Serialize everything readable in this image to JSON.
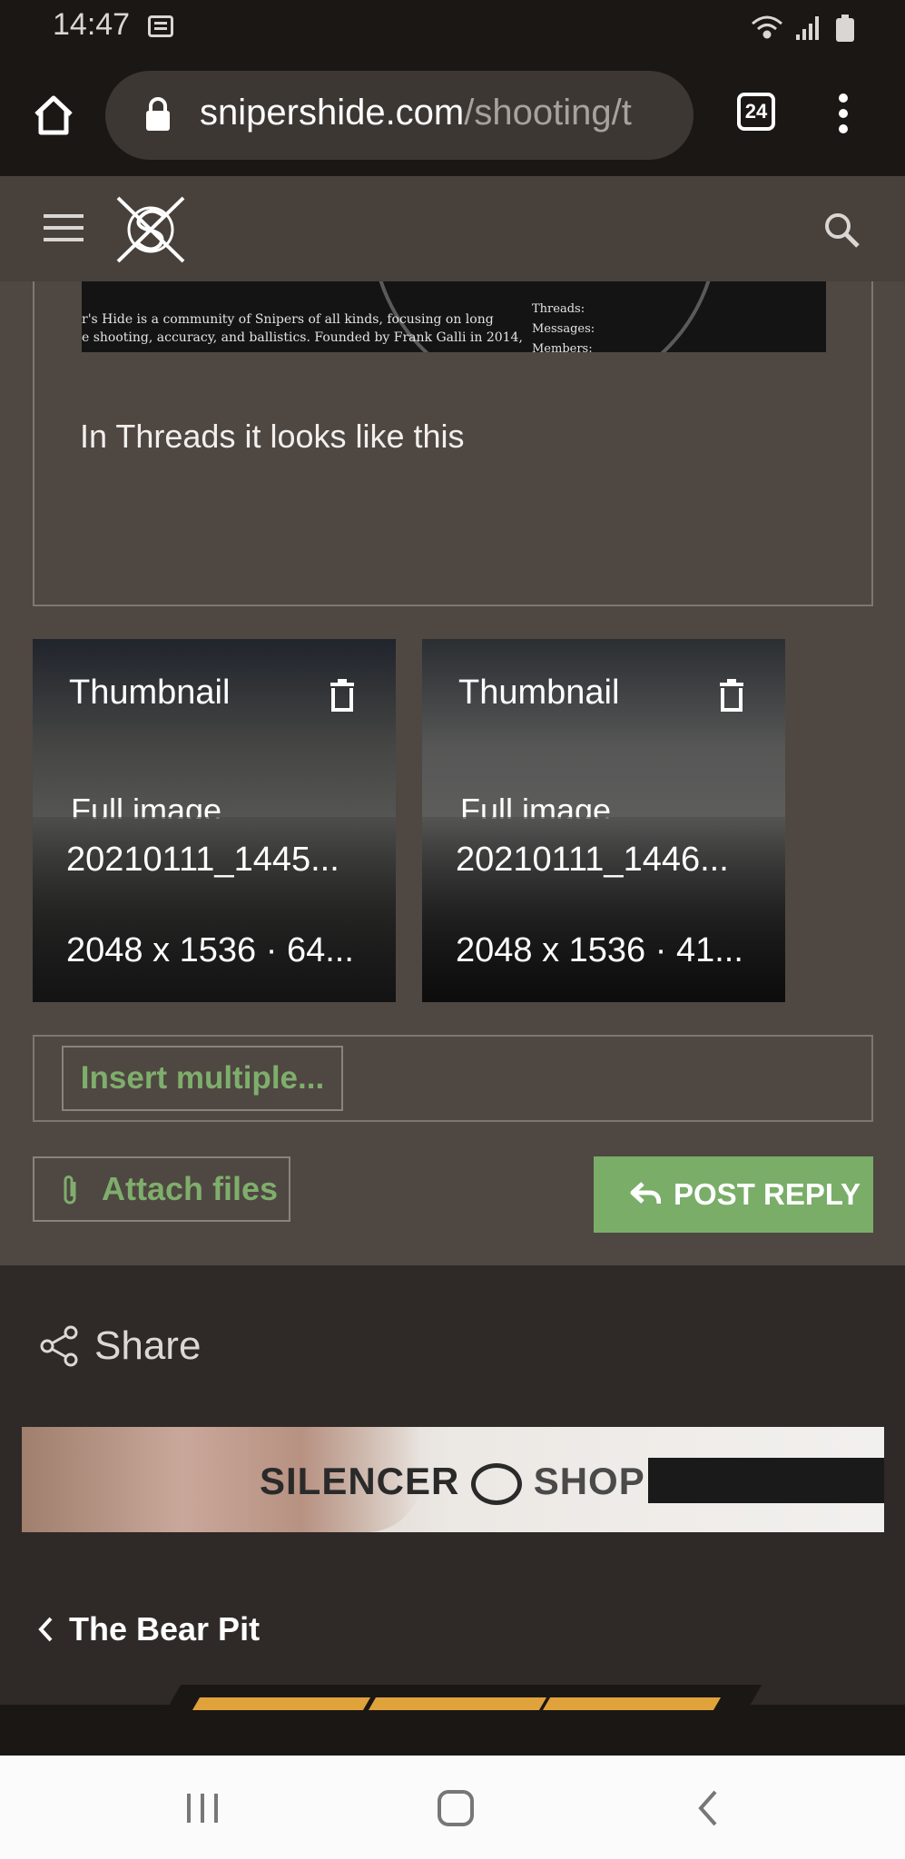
{
  "status_bar": {
    "time": "14:47",
    "icons": [
      "message-icon",
      "wifi-icon",
      "signal-icon",
      "battery-icon"
    ]
  },
  "browser": {
    "url_domain": "snipershide.com",
    "url_path": "/shooting/t",
    "tab_count": "24"
  },
  "site_header": {
    "icons": [
      "menu-icon",
      "snipers-hide-logo",
      "search-icon"
    ]
  },
  "editor": {
    "banner_text_line1": "r's Hide is a community of Snipers of all kinds, focusing on long",
    "banner_text_line2": "e shooting, accuracy, and ballistics. Founded by Frank Galli in 2014,",
    "banner_stats": [
      "Threads:",
      "Messages:",
      "Members:"
    ],
    "body_text": "In Threads it looks like this"
  },
  "attachments": [
    {
      "thumbnail_label": "Thumbnail",
      "full_label": "Full image",
      "filename": "20210111_1445...",
      "meta": "2048 x 1536 · 64..."
    },
    {
      "thumbnail_label": "Thumbnail",
      "full_label": "Full image",
      "filename": "20210111_1446...",
      "meta": "2048 x 1536 · 41..."
    }
  ],
  "actions": {
    "insert_multiple": "Insert multiple...",
    "attach_files": "Attach files",
    "post_reply": "POST REPLY"
  },
  "footer": {
    "share_label": "Share",
    "ad_text": "SILENCER",
    "ad_text2": "SHOP",
    "back_label": "The Bear Pit"
  },
  "colors": {
    "accent_green": "#79ad68",
    "link_green": "#7fae6c",
    "stripe_orange": "#e0a23a"
  }
}
